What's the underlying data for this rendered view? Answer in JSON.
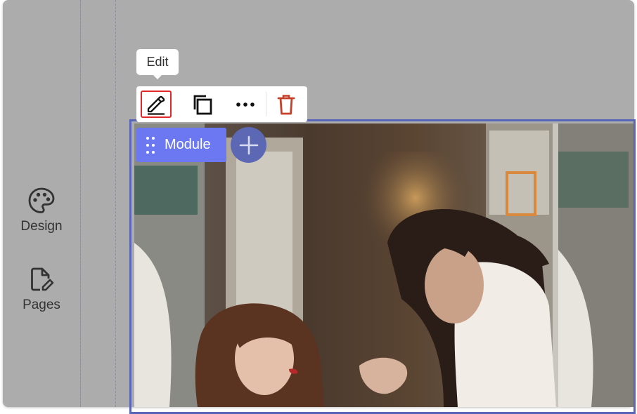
{
  "sidebar": {
    "items": [
      {
        "label": "Design",
        "icon": "palette-icon"
      },
      {
        "label": "Pages",
        "icon": "page-edit-icon"
      }
    ]
  },
  "tooltip": {
    "text": "Edit"
  },
  "toolbar": {
    "buttons": [
      {
        "icon": "pencil-icon",
        "state": "highlighted"
      },
      {
        "icon": "duplicate-icon"
      },
      {
        "icon": "more-icon"
      },
      {
        "icon": "trash-icon"
      }
    ]
  },
  "module": {
    "label": "Module"
  },
  "colors": {
    "overlay": "#acacac",
    "accent": "#6b78f2",
    "frame_border": "#5965b8",
    "highlight": "#e0282a",
    "delete": "#c5412a"
  }
}
